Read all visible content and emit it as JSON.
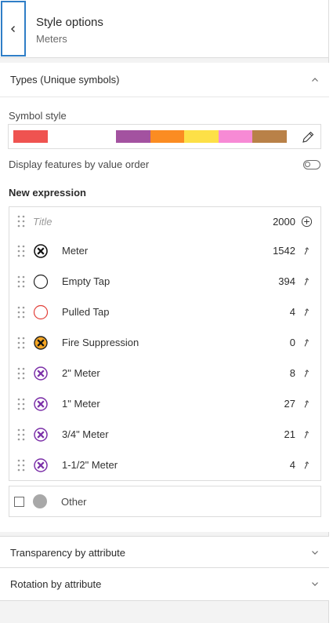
{
  "header": {
    "title": "Style options",
    "subtitle": "Meters"
  },
  "types": {
    "title": "Types (Unique symbols)",
    "symbol_style_label": "Symbol style",
    "ramp": [
      {
        "color": "#ef5350",
        "width": 44
      },
      {
        "color": "#ffffff",
        "width": 87
      },
      {
        "color": "#a352a0",
        "width": 44
      },
      {
        "color": "#fb8c22",
        "width": 43
      },
      {
        "color": "#fde047",
        "width": 44
      },
      {
        "color": "#f78ad5",
        "width": 43
      },
      {
        "color": "#b98148",
        "width": 44
      }
    ],
    "display_order_label": "Display features by value order",
    "expression_label": "New expression",
    "title_placeholder": "Title",
    "total_count": "2000",
    "items": [
      {
        "name": "Meter",
        "count": "1542",
        "symbol": "black-x-circle"
      },
      {
        "name": "Empty Tap",
        "count": "394",
        "symbol": "black-ring"
      },
      {
        "name": "Pulled Tap",
        "count": "4",
        "symbol": "red-ring"
      },
      {
        "name": "Fire Suppression",
        "count": "0",
        "symbol": "orange-x-circle"
      },
      {
        "name": "2\" Meter",
        "count": "8",
        "symbol": "purple-x-circle"
      },
      {
        "name": "1\" Meter",
        "count": "27",
        "symbol": "purple-x-circle"
      },
      {
        "name": "3/4\" Meter",
        "count": "21",
        "symbol": "purple-x-circle"
      },
      {
        "name": "1-1/2\" Meter",
        "count": "4",
        "symbol": "purple-x-circle"
      }
    ],
    "other_label": "Other"
  },
  "transparency": {
    "title": "Transparency by attribute"
  },
  "rotation": {
    "title": "Rotation by attribute"
  }
}
